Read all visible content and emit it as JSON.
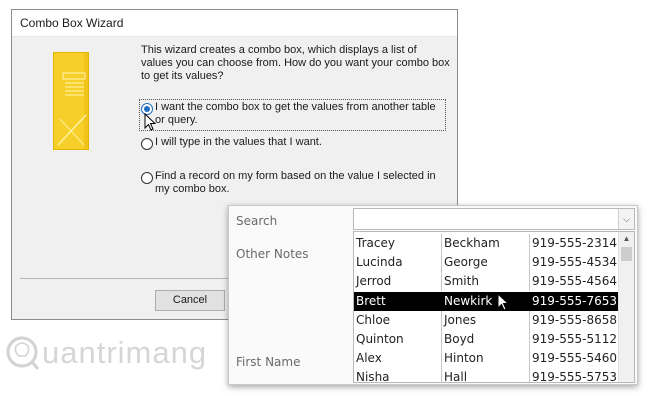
{
  "wizard": {
    "title": "Combo Box Wizard",
    "intro": "This wizard creates a combo box, which displays a list of values you can choose from.  How do you want your combo box to get its values?",
    "options": [
      {
        "label": "I want the combo box to get the values from another table or query.",
        "selected": true
      },
      {
        "label": "I will type in the values that I want.",
        "selected": false
      },
      {
        "label": "Find a record on my form based on the value I selected in my combo box.",
        "selected": false
      }
    ],
    "cancel_label": "Cancel"
  },
  "form": {
    "search_label": "Search",
    "other_notes_label": "Other Notes",
    "first_name_label": "First Name",
    "search_value": ""
  },
  "dropdown": {
    "rows": [
      {
        "first": "Tracey",
        "last": "Beckham",
        "phone": "919-555-2314"
      },
      {
        "first": "Lucinda",
        "last": "George",
        "phone": "919-555-4534"
      },
      {
        "first": "Jerrod",
        "last": "Smith",
        "phone": "919-555-4564"
      },
      {
        "first": "Brett",
        "last": "Newkirk",
        "phone": "919-555-7653"
      },
      {
        "first": "Chloe",
        "last": "Jones",
        "phone": "919-555-8658"
      },
      {
        "first": "Quinton",
        "last": "Boyd",
        "phone": "919-555-5112"
      },
      {
        "first": "Alex",
        "last": "Hinton",
        "phone": "919-555-5460"
      },
      {
        "first": "Nisha",
        "last": "Hall",
        "phone": "919-555-5753"
      }
    ],
    "selected_index": 3
  },
  "watermark": {
    "text": "uantrimang"
  },
  "colors": {
    "accent": "#1f6dc0",
    "selection": "#000000",
    "art": "#f7cf2a"
  }
}
